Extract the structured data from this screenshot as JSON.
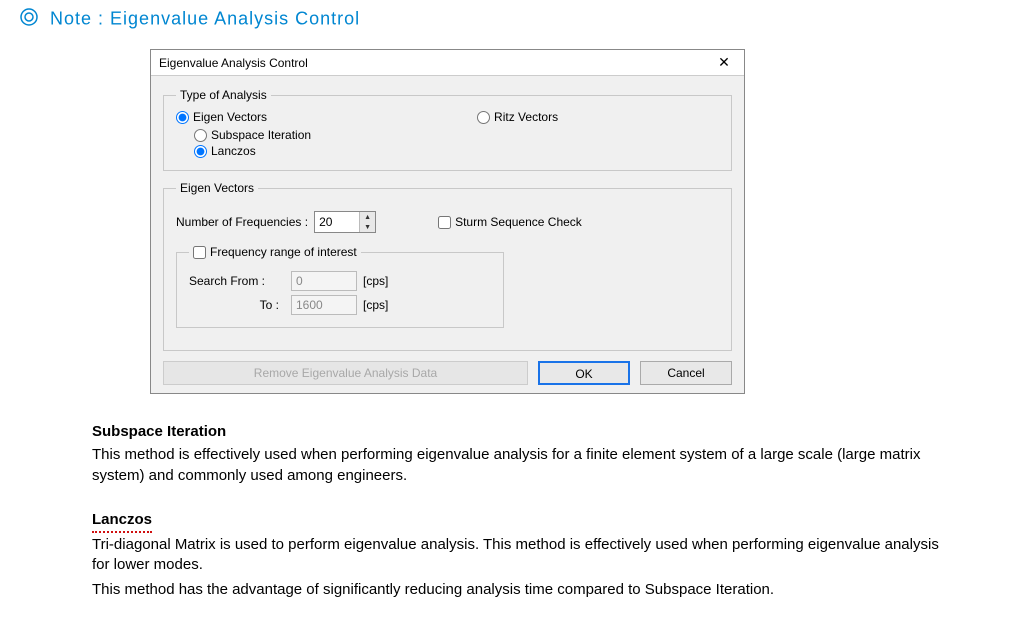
{
  "note_title": "Note : Eigenvalue Analysis  Control",
  "dialog": {
    "title": "Eigenvalue Analysis Control",
    "type_group": "Type of Analysis",
    "eigen_vectors": "Eigen Vectors",
    "ritz_vectors": "Ritz Vectors",
    "subspace_iteration": "Subspace Iteration",
    "lanczos": "Lanczos",
    "eigen_group": "Eigen Vectors",
    "num_freq_label": "Number of Frequencies  :",
    "num_freq_value": "20",
    "sturm": "Sturm Sequence Check",
    "frange_legend": "Frequency range of interest",
    "search_from": "Search From :",
    "search_to": "To :",
    "from_value": "0",
    "to_value": "1600",
    "unit": "[cps]",
    "remove": "Remove Eigenvalue Analysis Data",
    "ok": "OK",
    "cancel": "Cancel"
  },
  "explain": {
    "subspace_h": "Subspace Iteration",
    "subspace_p": "This method is effectively used when performing eigenvalue analysis for a finite element system of a large scale (large matrix system) and commonly used among engineers.",
    "lanczos_h": "Lanczos",
    "lanczos_p1": "Tri-diagonal Matrix is used to perform eigenvalue analysis. This method is effectively used when performing eigenvalue analysis for lower modes.",
    "lanczos_p2": "This method has the advantage of significantly reducing analysis time compared to Subspace Iteration."
  }
}
